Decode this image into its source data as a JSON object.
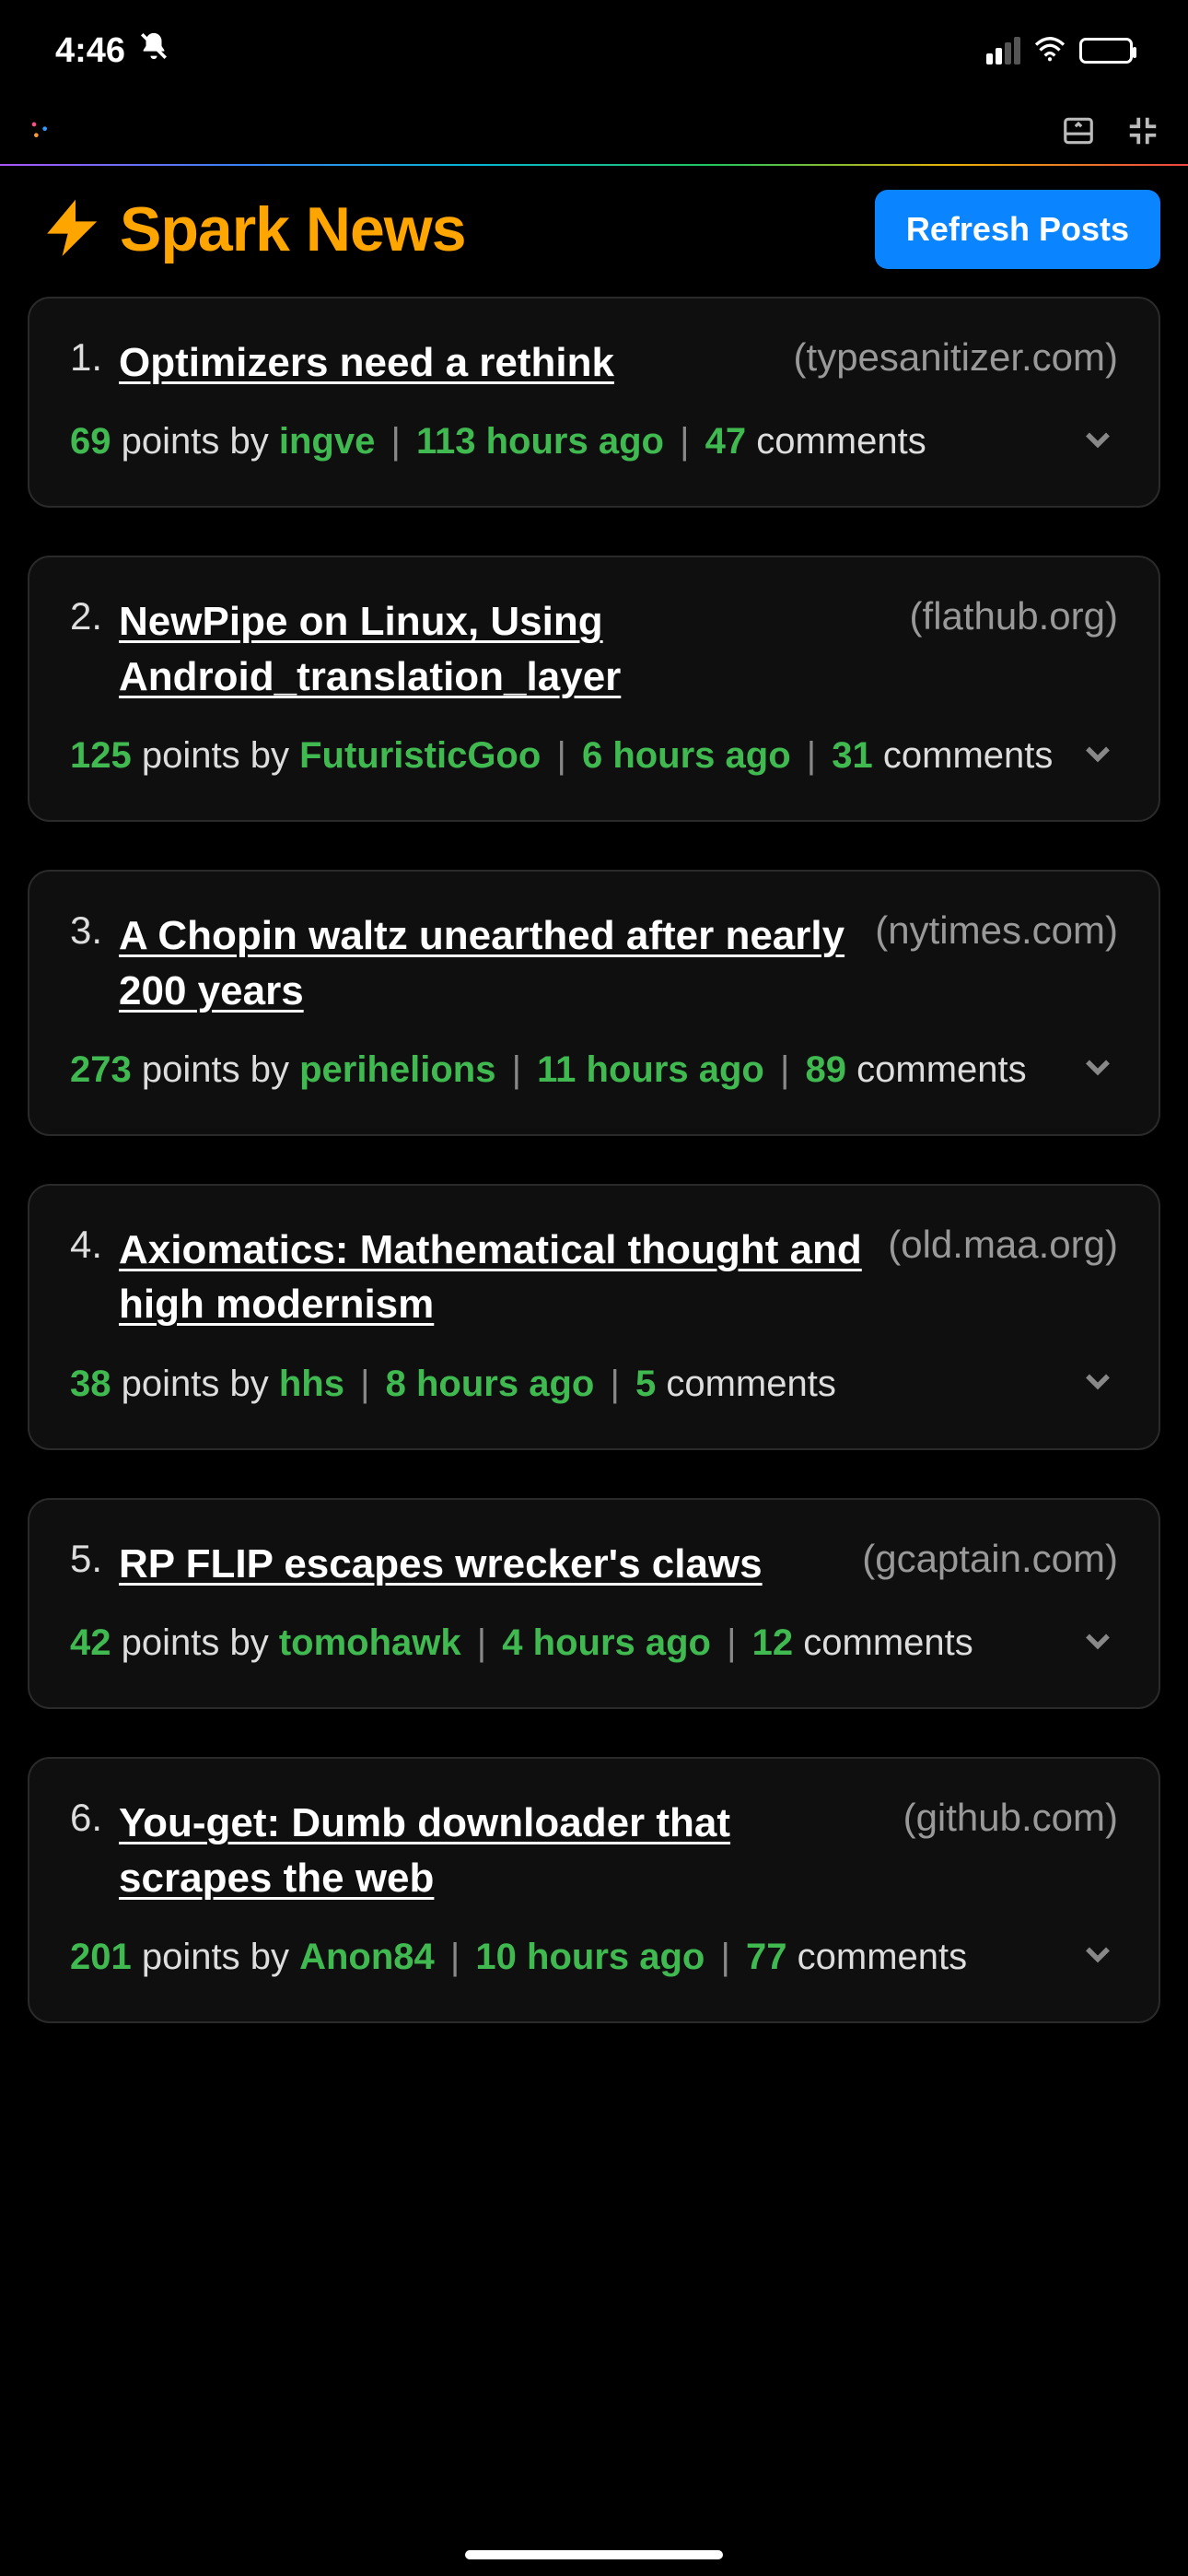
{
  "status_bar": {
    "time": "4:46"
  },
  "toolbar": {
    "label": ""
  },
  "header": {
    "title": "Spark News",
    "refresh_label": "Refresh Posts"
  },
  "template": {
    "points_word": "points",
    "by_word": "by",
    "comments_word": "comments",
    "sep": "|"
  },
  "posts": [
    {
      "rank": "1.",
      "title": "Optimizers need a rethink",
      "domain": "(typesanitizer.com)",
      "points": "69",
      "author": "ingve",
      "age": "113 hours ago",
      "comments": "47"
    },
    {
      "rank": "2.",
      "title": "NewPipe on Linux, Using Android_translation_layer",
      "domain": "(flathub.org)",
      "points": "125",
      "author": "FuturisticGoo",
      "age": "6 hours ago",
      "comments": "31"
    },
    {
      "rank": "3.",
      "title": "A Chopin waltz unearthed after nearly 200 years",
      "domain": "(nytimes.com)",
      "points": "273",
      "author": "perihelions",
      "age": "11 hours ago",
      "comments": "89"
    },
    {
      "rank": "4.",
      "title": "Axiomatics: Mathematical thought and high modernism",
      "domain": "(old.maa.org)",
      "points": "38",
      "author": "hhs",
      "age": "8 hours ago",
      "comments": "5"
    },
    {
      "rank": "5.",
      "title": "RP FLIP escapes wrecker's claws",
      "domain": "(gcaptain.com)",
      "points": "42",
      "author": "tomohawk",
      "age": "4 hours ago",
      "comments": "12"
    },
    {
      "rank": "6.",
      "title": "You-get: Dumb downloader that scrapes the web",
      "domain": "(github.com)",
      "points": "201",
      "author": "Anon84",
      "age": "10 hours ago",
      "comments": "77"
    }
  ]
}
